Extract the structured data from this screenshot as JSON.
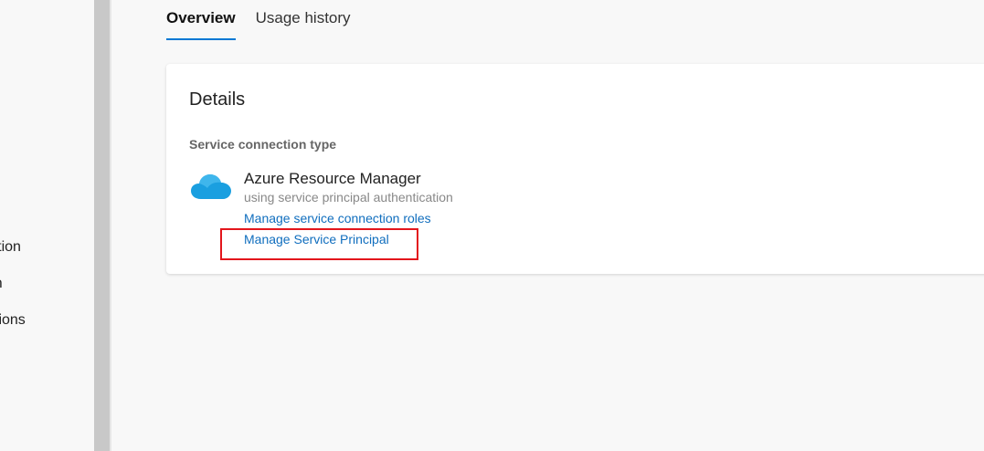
{
  "left_nav": {
    "items": [
      {
        "label": "uration"
      },
      {
        "label": "ation"
      },
      {
        "label": "ctions"
      }
    ]
  },
  "tabs": [
    {
      "label": "Overview",
      "active": true
    },
    {
      "label": "Usage history",
      "active": false
    }
  ],
  "details": {
    "title": "Details",
    "section_label": "Service connection type",
    "service": {
      "name": "Azure Resource Manager",
      "description": "using service principal authentication",
      "icon": "cloud-icon"
    },
    "links": {
      "manage_roles": "Manage service connection roles",
      "manage_principal": "Manage Service Principal"
    }
  },
  "colors": {
    "accent": "#0078d4",
    "link": "#106ebe",
    "highlight": "#e3161c",
    "cloud": "#1a9fe0"
  }
}
